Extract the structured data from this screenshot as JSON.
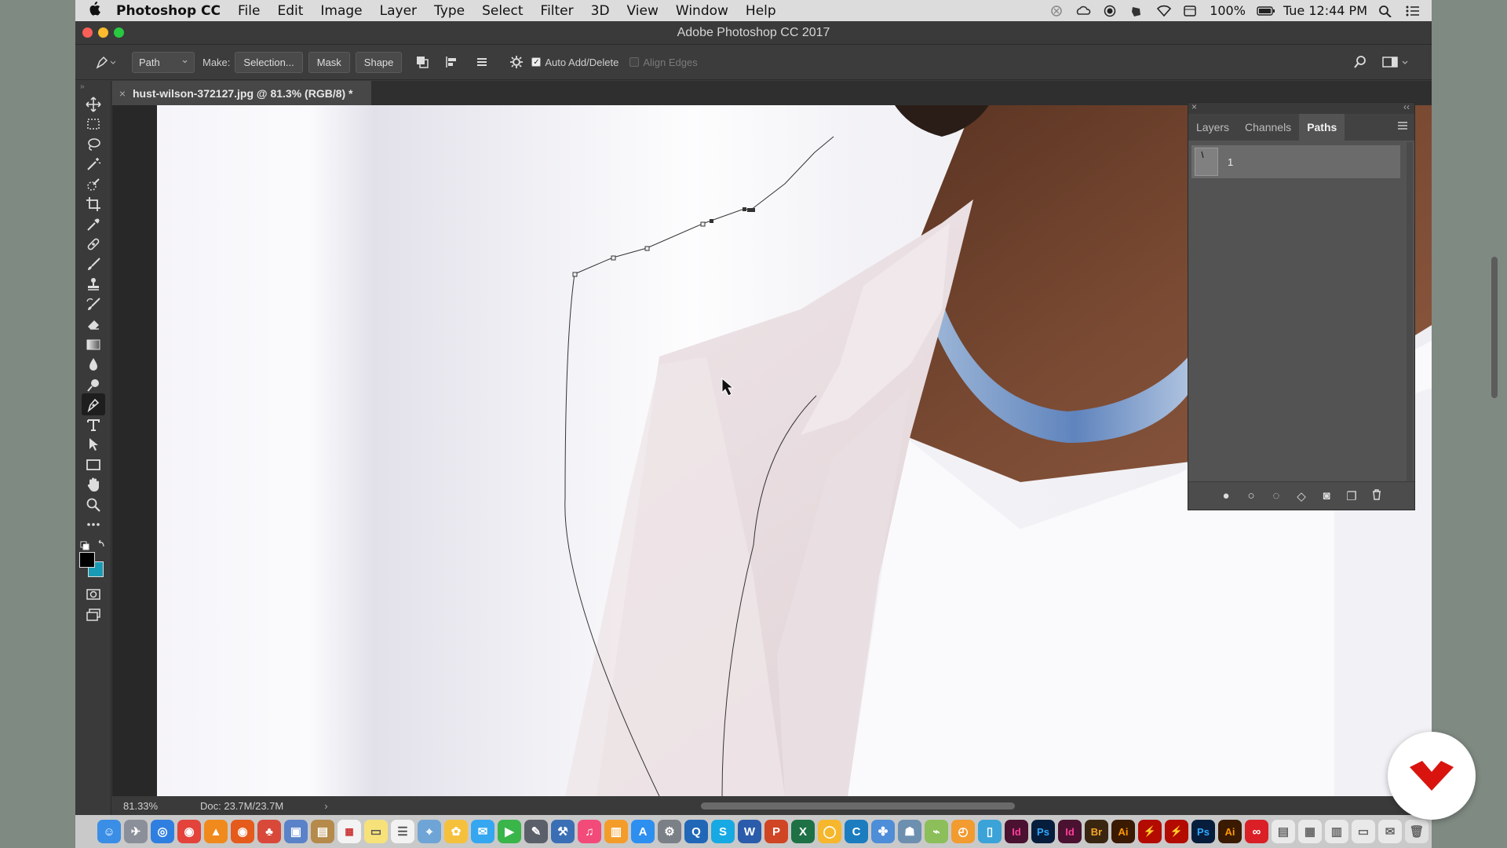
{
  "menubar": {
    "app_name": "Photoshop CC",
    "items": [
      "File",
      "Edit",
      "Image",
      "Layer",
      "Type",
      "Select",
      "Filter",
      "3D",
      "View",
      "Window",
      "Help"
    ],
    "battery": "100%",
    "clock": "Tue 12:44 PM"
  },
  "window": {
    "title": "Adobe Photoshop CC 2017"
  },
  "options": {
    "mode_value": "Path",
    "make_label": "Make:",
    "selection_button": "Selection...",
    "mask_button": "Mask",
    "shape_button": "Shape",
    "auto_add_delete_label": "Auto Add/Delete",
    "auto_add_delete_checked": true,
    "align_edges_label": "Align Edges",
    "align_edges_checked": false
  },
  "document": {
    "tab_label": "hust-wilson-372127.jpg @ 81.3% (RGB/8) *"
  },
  "status": {
    "zoom": "81.33%",
    "doc_size": "Doc: 23.7M/23.7M"
  },
  "panel": {
    "tabs": [
      "Layers",
      "Channels",
      "Paths"
    ],
    "active_tab": "Paths",
    "path_items": [
      {
        "name": "1"
      }
    ]
  },
  "colors": {
    "accent": "#1a9bb5",
    "foreground": "#000000",
    "background_swatch": "#1a9bb5",
    "brand_badge": "#d9140e"
  }
}
